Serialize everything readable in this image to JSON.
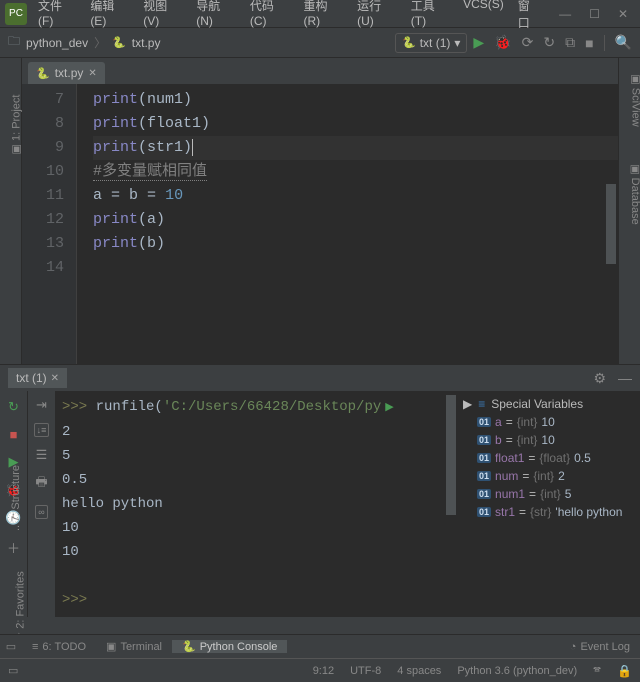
{
  "menu": {
    "file": "文件(F)",
    "edit": "编辑(E)",
    "view": "视图(V)",
    "nav": "导航(N)",
    "code": "代码(C)",
    "refactor": "重构(R)",
    "run": "运行(U)",
    "tools": "工具(T)",
    "vcs": "VCS(S)",
    "window": "窗口"
  },
  "breadcrumb": {
    "project": "python_dev",
    "file": "txt.py"
  },
  "run_config": {
    "label": "txt (1)"
  },
  "editor_tab": {
    "label": "txt.py"
  },
  "code_lines": {
    "7": [
      "print",
      "(",
      "num1",
      ")"
    ],
    "8": [
      "print",
      "(",
      "float1",
      ")"
    ],
    "9": [
      "print",
      "(",
      "str1",
      ")"
    ],
    "10": "",
    "11": "#多变量赋相同值",
    "12": [
      "a",
      " = ",
      "b",
      " = ",
      "10"
    ],
    "13": [
      "print",
      "(",
      "a",
      ")"
    ],
    "14": [
      "print",
      "(",
      "b",
      ")"
    ]
  },
  "left_tool": {
    "project": "1: Project"
  },
  "left_tools2": {
    "structure": "7: Structure",
    "favorites": "2: Favorites"
  },
  "right_tools": {
    "sciview": "SciView",
    "database": "Database"
  },
  "console_tab": {
    "label": "txt (1)"
  },
  "console": {
    "cmd_prefix": ">>> ",
    "cmd": "runfile(",
    "cmd_str": "'C:/Users/66428/Desktop/py",
    "out": [
      "2",
      "5",
      "0.5",
      "hello python",
      "10",
      "10"
    ],
    "prompt": ">>>"
  },
  "vars": {
    "header": "Special Variables",
    "rows": [
      {
        "n": "a",
        "t": "{int}",
        "v": "10"
      },
      {
        "n": "b",
        "t": "{int}",
        "v": "10"
      },
      {
        "n": "float1",
        "t": "{float}",
        "v": "0.5"
      },
      {
        "n": "num",
        "t": "{int}",
        "v": "2"
      },
      {
        "n": "num1",
        "t": "{int}",
        "v": "5"
      },
      {
        "n": "str1",
        "t": "{str}",
        "v": "'hello python"
      }
    ]
  },
  "bottom": {
    "todo": "6: TODO",
    "terminal": "Terminal",
    "console": "Python Console",
    "eventlog": "Event Log"
  },
  "status": {
    "pos": "9:12",
    "enc": "UTF-8",
    "indent": "4 spaces",
    "sdk": "Python 3.6 (python_dev)"
  }
}
